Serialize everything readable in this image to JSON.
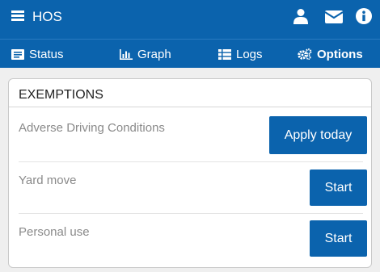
{
  "header": {
    "title": "HOS",
    "icons": [
      "menu-icon",
      "user-icon",
      "mail-icon",
      "info-icon"
    ]
  },
  "tabs": [
    {
      "label": "Status",
      "icon": "status-icon",
      "active": false
    },
    {
      "label": "Graph",
      "icon": "graph-icon",
      "active": false
    },
    {
      "label": "Logs",
      "icon": "logs-icon",
      "active": false
    },
    {
      "label": "Options",
      "icon": "options-icon",
      "active": true
    }
  ],
  "exemptions": {
    "title": "EXEMPTIONS",
    "items": [
      {
        "label": "Adverse Driving Conditions",
        "button": "Apply today"
      },
      {
        "label": "Yard move",
        "button": "Start"
      },
      {
        "label": "Personal use",
        "button": "Start"
      }
    ]
  },
  "colors": {
    "brand": "#0b63ad",
    "background": "#efefef",
    "card": "#ffffff",
    "muted_text": "#8a8a8a"
  }
}
